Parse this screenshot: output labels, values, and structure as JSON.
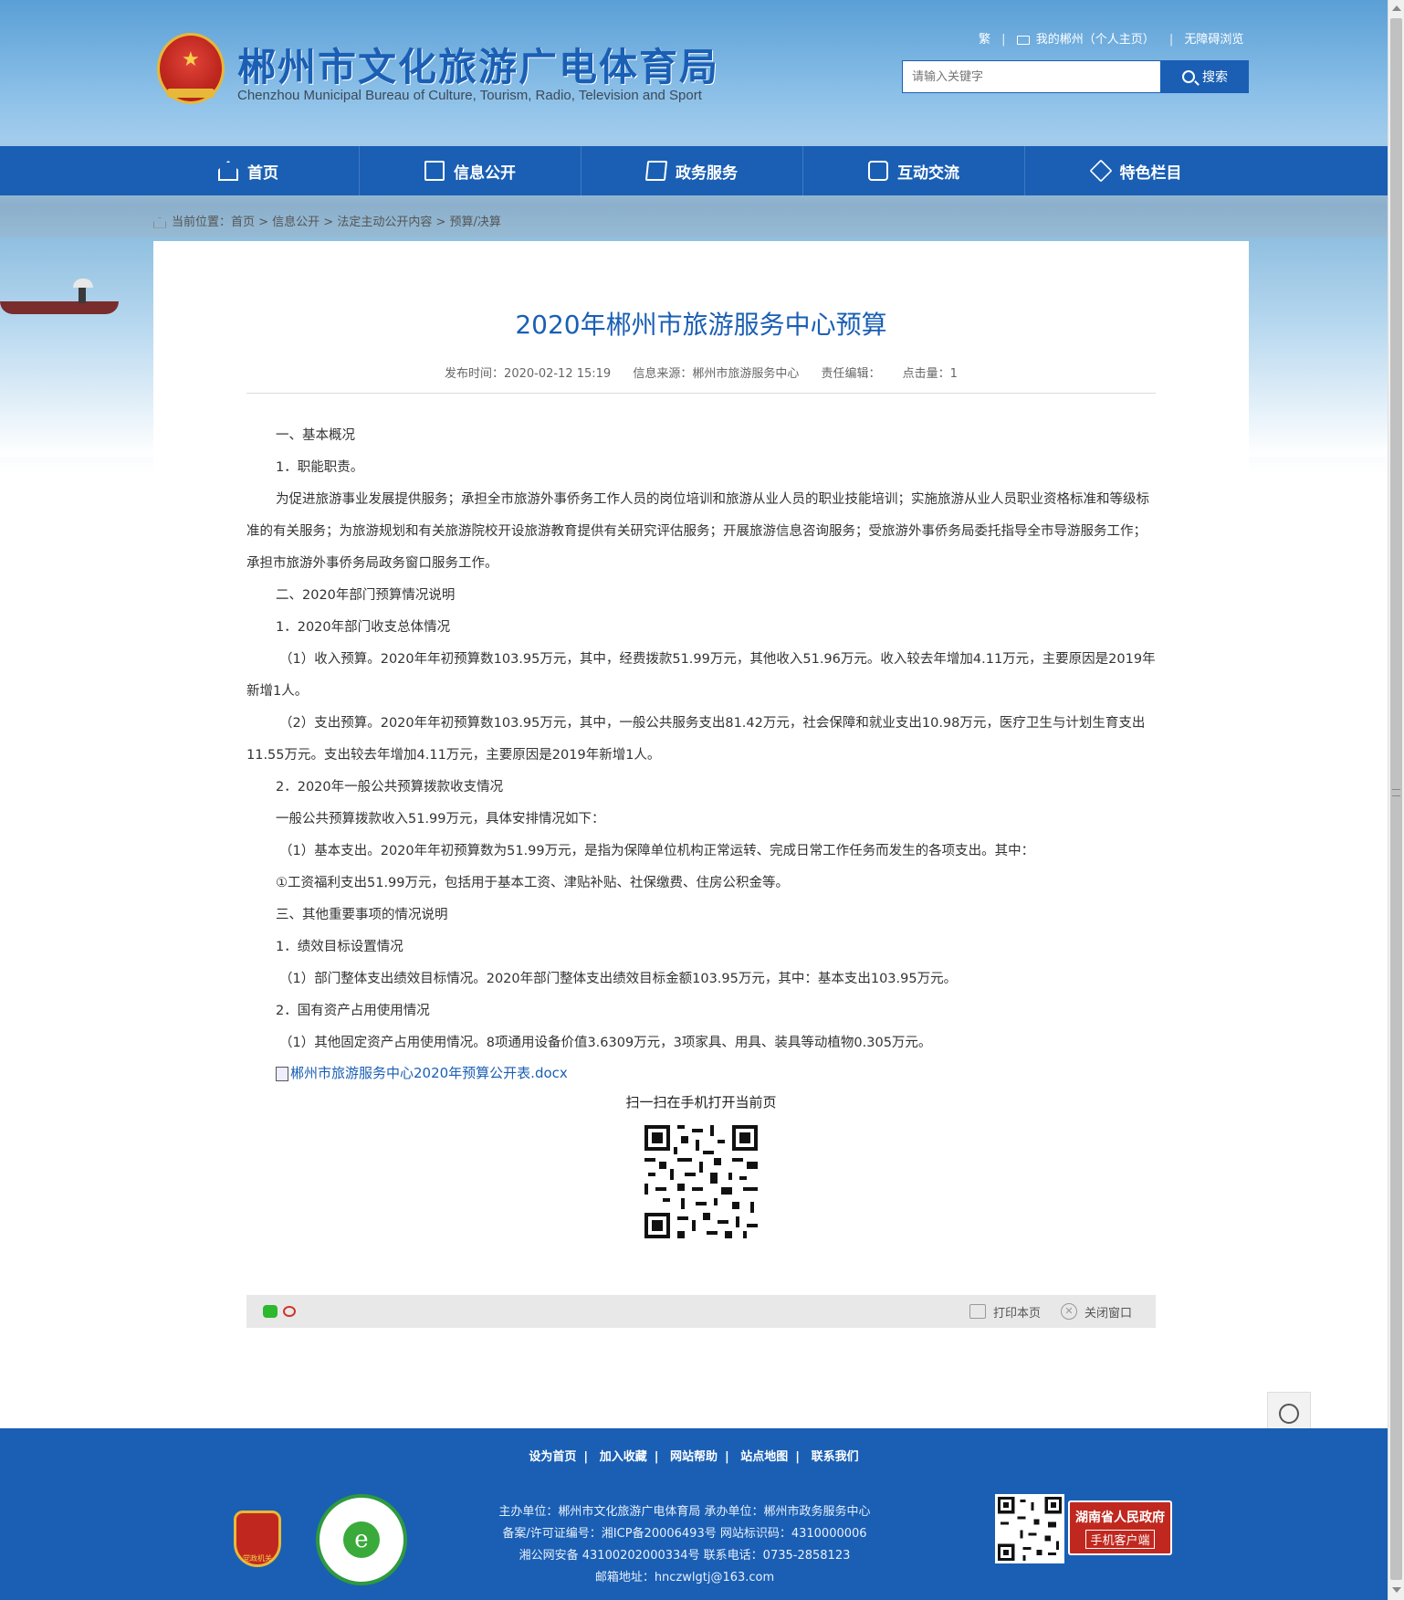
{
  "header": {
    "title": "郴州市文化旅游广电体育局",
    "subtitle": "Chenzhou Municipal Bureau of Culture, Tourism, Radio, Television and Sport",
    "links": [
      "繁",
      "我的郴州（个人主页）",
      "无障碍浏览"
    ],
    "search": {
      "placeholder": "请输入关键字",
      "button": "搜索"
    }
  },
  "nav": {
    "items": [
      {
        "label": "首页",
        "icon": "home-icon"
      },
      {
        "label": "信息公开",
        "icon": "document-icon"
      },
      {
        "label": "政务服务",
        "icon": "edit-icon"
      },
      {
        "label": "互动交流",
        "icon": "chat-icon"
      },
      {
        "label": "特色栏目",
        "icon": "layers-icon"
      }
    ]
  },
  "breadcrumb": {
    "label": "当前位置：",
    "path": "首页 > 信息公开 > 法定主动公开内容 > 预算/决算"
  },
  "article": {
    "title": "2020年郴州市旅游服务中心预算",
    "meta": {
      "published": "发布时间：2020-02-12 15:19",
      "source": "信息来源：郴州市旅游服务中心",
      "editor": "责任编辑：",
      "views": "点击量：1"
    },
    "paragraphs": [
      "一、基本概况",
      "1．职能职责。",
      "为促进旅游事业发展提供服务；承担全市旅游外事侨务工作人员的岗位培训和旅游从业人员的职业技能培训；实施旅游从业人员职业资格标准和等级标准的有关服务；为旅游规划和有关旅游院校开设旅游教育提供有关研究评估服务；开展旅游信息咨询服务；受旅游外事侨务局委托指导全市导游服务工作；承担市旅游外事侨务局政务窗口服务工作。",
      "二、2020年部门预算情况说明",
      "1．2020年部门收支总体情况",
      "（1）收入预算。2020年年初预算数103.95万元，其中，经费拨款51.99万元，其他收入51.96万元。收入较去年增加4.11万元，主要原因是2019年新增1人。",
      "（2）支出预算。2020年年初预算数103.95万元，其中，一般公共服务支出81.42万元，社会保障和就业支出10.98万元，医疗卫生与计划生育支出11.55万元。支出较去年增加4.11万元，主要原因是2019年新增1人。",
      "2．2020年一般公共预算拨款收支情况",
      "一般公共预算拨款收入51.99万元，具体安排情况如下：",
      "（1）基本支出。2020年年初预算数为51.99万元，是指为保障单位机构正常运转、完成日常工作任务而发生的各项支出。其中：",
      "①工资福利支出51.99万元，包括用于基本工资、津贴补贴、社保缴费、住房公积金等。",
      "三、其他重要事项的情况说明",
      "1．绩效目标设置情况",
      "（1）部门整体支出绩效目标情况。2020年部门整体支出绩效目标金额103.95万元，其中：基本支出103.95万元。",
      "2．国有资产占用使用情况",
      "（1）其他固定资产占用使用情况。8项通用设备价值3.6309万元，3项家具、用具、装具等动植物0.305万元。"
    ],
    "attachment": "郴州市旅游服务中心2020年预算公开表.docx",
    "qr_caption": "扫一扫在手机打开当前页",
    "print": "打印本页",
    "close": "关闭窗口"
  },
  "footer": {
    "links": [
      "设为首页",
      "加入收藏",
      "网站帮助",
      "站点地图",
      "联系我们"
    ],
    "info": [
      "主办单位：郴州市文化旅游广电体育局   承办单位：郴州市政务服务中心",
      "备案/许可证编号：湘ICP备20006493号   网站标识码：4310000006",
      "湘公网安备 43100202000334号   联系电话：0735-2858123",
      "邮箱地址：hnczwlgtj@163.com"
    ],
    "party_badge": "党政机关",
    "civil_badge": "e",
    "gov_app": {
      "line1": "湖南省人民政府",
      "line2": "手机客户端"
    }
  },
  "colors": {
    "primary": "#1a5fb4",
    "red": "#c0281f",
    "gold": "#e8b838"
  }
}
